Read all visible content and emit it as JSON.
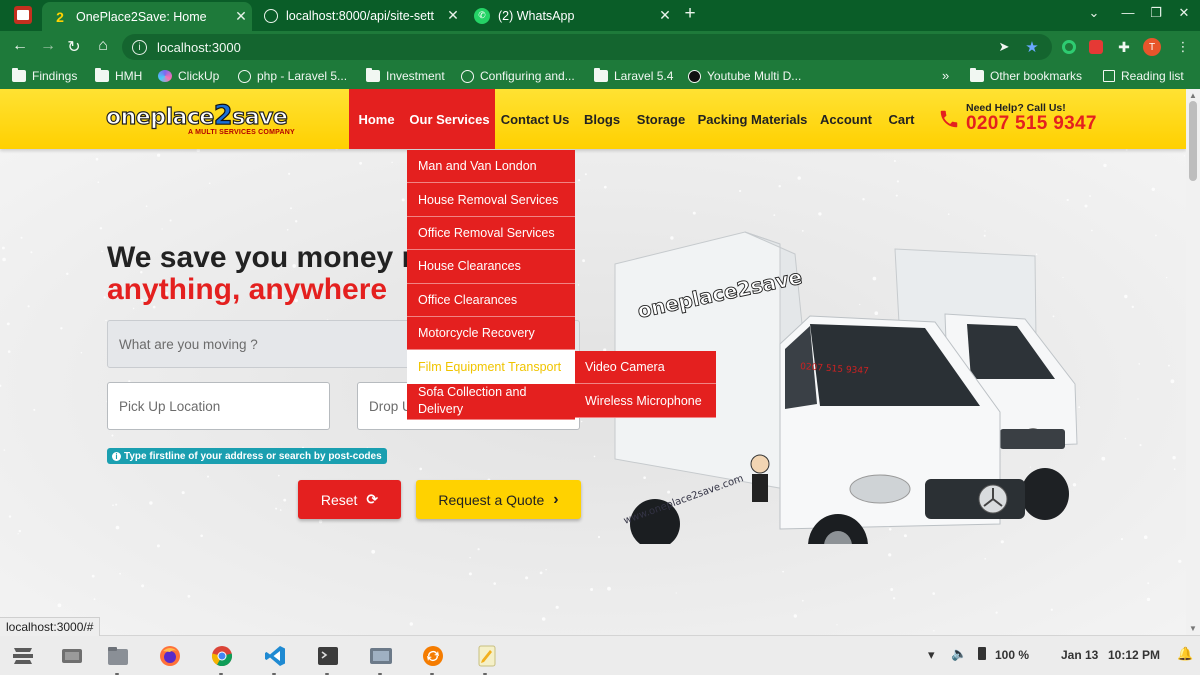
{
  "browser": {
    "tabs": [
      {
        "title": "OnePlace2Save: Home",
        "favicon_text": "2",
        "active": true
      },
      {
        "title": "localhost:8000/api/site-sett",
        "favicon_text": "",
        "active": false
      },
      {
        "title": "(2) WhatsApp",
        "favicon_text": "",
        "active": false
      }
    ],
    "url": "localhost:3000",
    "new_tab_symbol": "+",
    "profile_initial": "T",
    "bookmarks": [
      {
        "label": "Findings",
        "icon": "folder-icon"
      },
      {
        "label": "HMH",
        "icon": "folder-icon"
      },
      {
        "label": "ClickUp",
        "icon": "clickup-icon"
      },
      {
        "label": "php - Laravel 5...",
        "icon": "globe-icon"
      },
      {
        "label": "Investment",
        "icon": "folder-icon"
      },
      {
        "label": "Configuring and...",
        "icon": "globe-icon"
      },
      {
        "label": "Laravel 5.4",
        "icon": "folder-icon"
      },
      {
        "label": "Youtube Multi D...",
        "icon": "youtube-icon"
      }
    ],
    "bookmarks_overflow": "»",
    "other_bookmarks": "Other bookmarks",
    "reading_list": "Reading list",
    "status_url": "localhost:3000/#"
  },
  "site": {
    "logo": {
      "part1": "oneplace",
      "part2": "2",
      "part3": "save",
      "tagline": "A MULTI SERVICES COMPANY"
    },
    "nav": [
      "Home",
      "Our Services",
      "Contact Us",
      "Blogs",
      "Storage",
      "Packing Materials",
      "Account",
      "Cart"
    ],
    "help": {
      "label": "Need Help? Call Us!",
      "phone": "0207 515 9347"
    },
    "services_menu": [
      "Man and Van London",
      "House Removal Services",
      "Office Removal Services",
      "House Clearances",
      "Office Clearances",
      "Motorcycle Recovery",
      "Film Equipment Transport",
      "Sofa Collection and Delivery"
    ],
    "services_submenu": [
      "Video Camera",
      "Wireless Microphone"
    ],
    "hero": {
      "line1": "We save you money m",
      "line2": "anything, anywhere"
    },
    "form": {
      "moving_placeholder": "What are you moving ?",
      "pickup_placeholder": "Pick Up Location",
      "dropoff_placeholder": "Drop U",
      "hint": "Type firstline of your address or search by post-codes",
      "reset_label": "Reset",
      "quote_label": "Request a Quote"
    },
    "van_text": {
      "brand": "oneplace2save",
      "phone": "0207 515 9347",
      "web": "www.oneplace2save.com"
    }
  },
  "taskbar": {
    "battery": "100 %",
    "date": "Jan 13",
    "time": "10:12 PM"
  },
  "colors": {
    "chrome_dark": "#0a5d28",
    "chrome": "#1e7a3a",
    "brand_yellow": "#ffd200",
    "brand_red": "#e4201f"
  }
}
